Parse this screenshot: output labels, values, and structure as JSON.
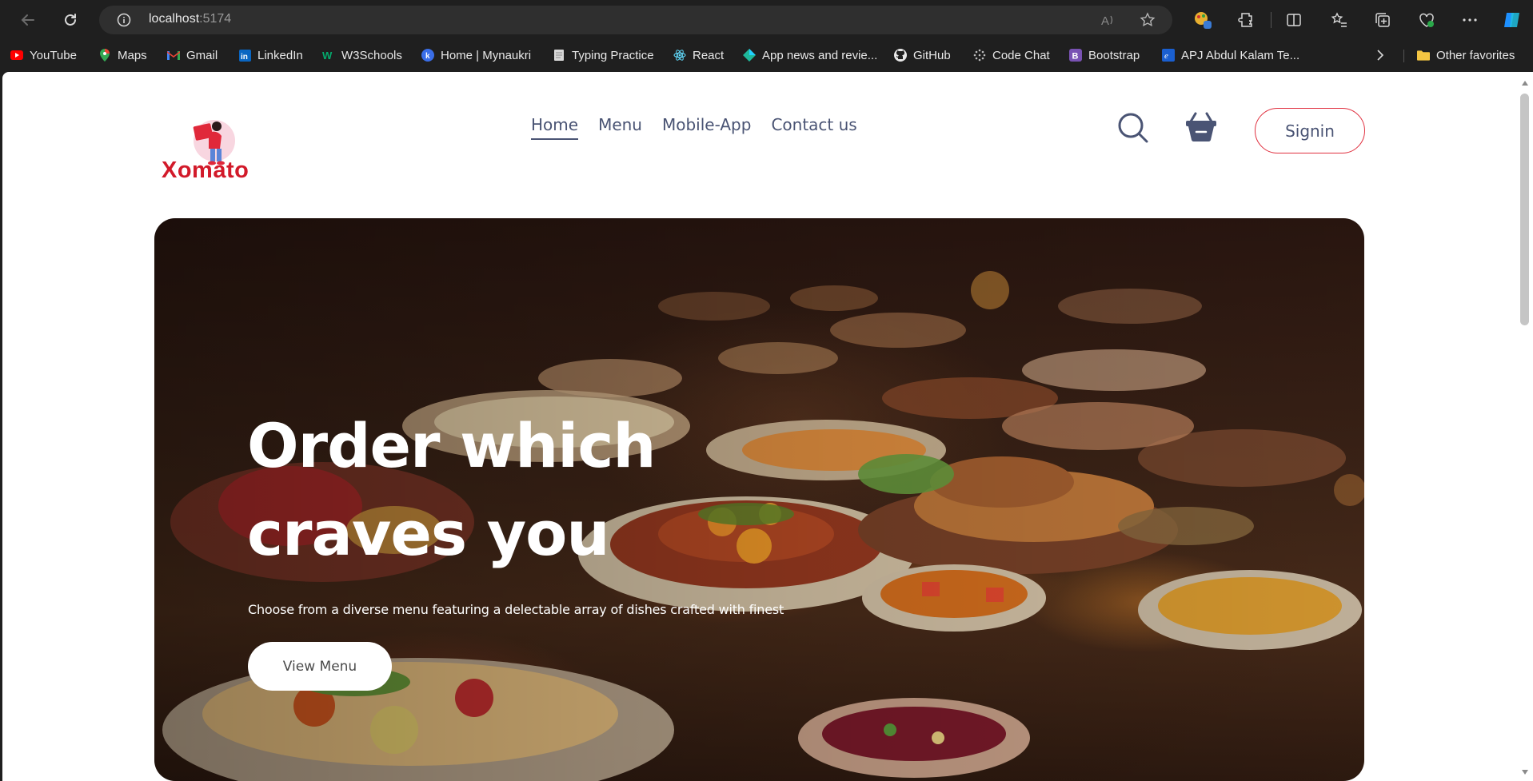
{
  "browser": {
    "url_host": "localhost",
    "url_port": ":5174",
    "bookmarks": [
      {
        "label": "YouTube",
        "icon": "youtube-icon"
      },
      {
        "label": "Maps",
        "icon": "maps-icon"
      },
      {
        "label": "Gmail",
        "icon": "gmail-icon"
      },
      {
        "label": "LinkedIn",
        "icon": "linkedin-icon"
      },
      {
        "label": "W3Schools",
        "icon": "w3schools-icon"
      },
      {
        "label": "Home | Mynaukri",
        "icon": "mynaukri-icon"
      },
      {
        "label": "Typing Practice",
        "icon": "typing-icon"
      },
      {
        "label": "React",
        "icon": "react-icon"
      },
      {
        "label": "App news and revie...",
        "icon": "app-news-icon"
      },
      {
        "label": "GitHub",
        "icon": "github-icon"
      },
      {
        "label": "Code Chat",
        "icon": "code-chat-icon"
      },
      {
        "label": "Bootstrap",
        "icon": "bootstrap-icon"
      },
      {
        "label": "APJ Abdul Kalam Te...",
        "icon": "apj-icon"
      }
    ],
    "other_favorites": "Other favorites"
  },
  "site": {
    "logo_text": "Xomato",
    "nav": [
      {
        "label": "Home",
        "active": true
      },
      {
        "label": "Menu",
        "active": false
      },
      {
        "label": "Mobile-App",
        "active": false
      },
      {
        "label": "Contact us",
        "active": false
      }
    ],
    "signin_label": "Signin",
    "colors": {
      "brand_red": "#d21a2a",
      "nav_text": "#4a5474",
      "signin_border": "#e0303f"
    }
  },
  "hero": {
    "title": "Order which craves you",
    "subtitle": "Choose from a diverse menu featuring a delectable array of dishes crafted with finest",
    "cta_label": "View Menu"
  }
}
